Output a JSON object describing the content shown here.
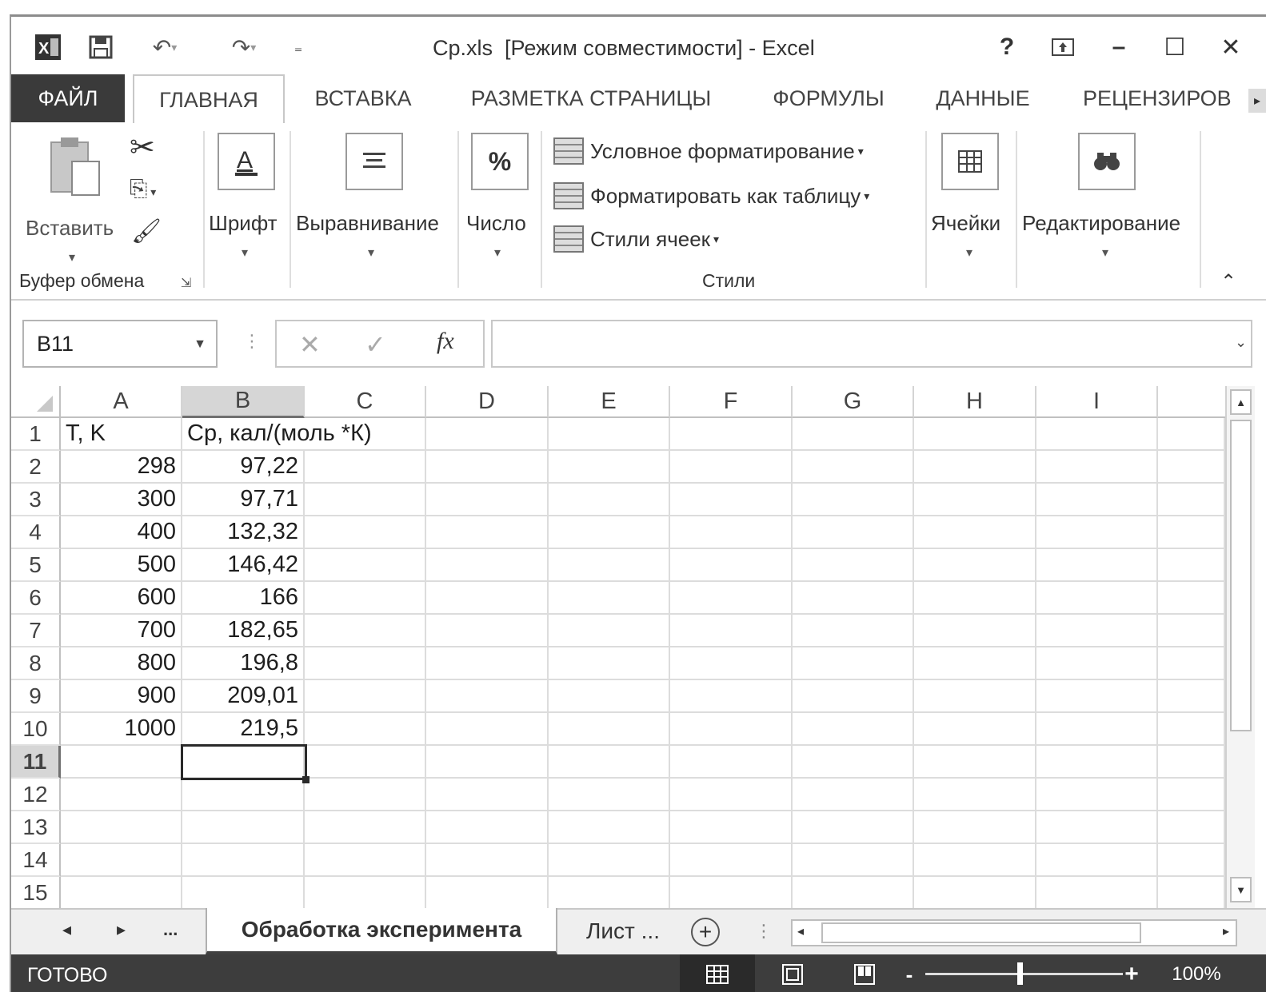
{
  "titlebar": {
    "title": "Cp.xls  [Режим совместимости] - Excel",
    "qa_save": "save",
    "help": "?",
    "minimize": "–",
    "maximize": "☐",
    "close": "✕"
  },
  "tabs": [
    {
      "label": "ФАЙЛ"
    },
    {
      "label": "ГЛАВНАЯ"
    },
    {
      "label": "ВСТАВКА"
    },
    {
      "label": "РАЗМЕТКА СТРАНИЦЫ"
    },
    {
      "label": "ФОРМУЛЫ"
    },
    {
      "label": "ДАННЫЕ"
    },
    {
      "label": "РЕЦЕНЗИРОВ"
    }
  ],
  "ribbon": {
    "paste": "Вставить",
    "clipboard_group": "Буфер обмена",
    "font": "Шрифт",
    "alignment": "Выравнивание",
    "number": "Число",
    "conditional_formatting": "Условное форматирование",
    "format_as_table": "Форматировать как таблицу",
    "cell_styles": "Стили ячеек",
    "styles_group": "Стили",
    "cells": "Ячейки",
    "editing": "Редактирование"
  },
  "formula_bar": {
    "name_box": "B11",
    "formula": ""
  },
  "grid": {
    "columns": [
      "A",
      "B",
      "C",
      "D",
      "E",
      "F",
      "G",
      "H",
      "I"
    ],
    "selected_column": "B",
    "row_numbers": [
      "1",
      "2",
      "3",
      "4",
      "5",
      "6",
      "7",
      "8",
      "9",
      "10",
      "11",
      "12",
      "13",
      "14",
      "15"
    ],
    "selected_row": "11",
    "header_row": {
      "A": "T, K",
      "B": "Cp, кал/(моль *К)"
    },
    "data": [
      {
        "A": "298",
        "B": "97,22"
      },
      {
        "A": "300",
        "B": "97,71"
      },
      {
        "A": "400",
        "B": "132,32"
      },
      {
        "A": "500",
        "B": "146,42"
      },
      {
        "A": "600",
        "B": "166"
      },
      {
        "A": "700",
        "B": "182,65"
      },
      {
        "A": "800",
        "B": "196,8"
      },
      {
        "A": "900",
        "B": "209,01"
      },
      {
        "A": "1000",
        "B": "219,5"
      }
    ]
  },
  "sheets": {
    "ellipsis": "...",
    "active": "Обработка эксперимента",
    "other": "Лист ...",
    "add": "+"
  },
  "status": {
    "ready": "ГОТОВО",
    "zoom_minus": "-",
    "zoom_plus": "+",
    "zoom": "100%"
  }
}
